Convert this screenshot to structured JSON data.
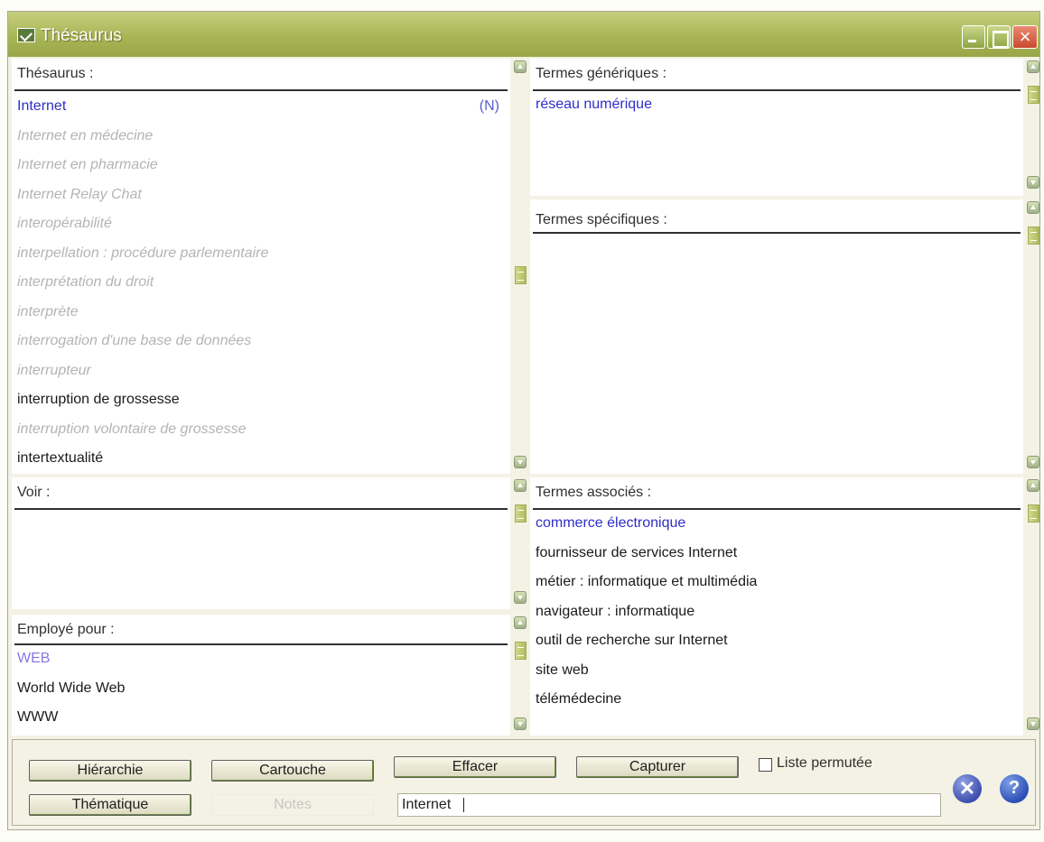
{
  "window": {
    "title": "Thésaurus"
  },
  "thesaurus": {
    "title": "Thésaurus :",
    "items": [
      {
        "label": "Internet",
        "style": "blue",
        "tag": "(N)"
      },
      {
        "label": "Internet en médecine",
        "style": "grey"
      },
      {
        "label": "Internet en pharmacie",
        "style": "grey"
      },
      {
        "label": "Internet Relay Chat",
        "style": "grey"
      },
      {
        "label": "interopérabilité",
        "style": "grey"
      },
      {
        "label": "interpellation : procédure parlementaire",
        "style": "grey"
      },
      {
        "label": "interprétation du droit",
        "style": "grey"
      },
      {
        "label": "interprète",
        "style": "grey"
      },
      {
        "label": "interrogation d'une base de données",
        "style": "grey"
      },
      {
        "label": "interrupteur",
        "style": "grey"
      },
      {
        "label": "interruption de grossesse",
        "style": "black"
      },
      {
        "label": "interruption volontaire de grossesse",
        "style": "grey"
      },
      {
        "label": "intertextualité",
        "style": "black"
      }
    ]
  },
  "voir": {
    "title": "Voir :"
  },
  "employe_pour": {
    "title": "Employé pour :",
    "items": [
      {
        "label": "WEB",
        "style": "lilac"
      },
      {
        "label": "World Wide Web",
        "style": "black"
      },
      {
        "label": "WWW",
        "style": "black"
      }
    ]
  },
  "termes_generiques": {
    "title": "Termes génériques :",
    "items": [
      {
        "label": "réseau numérique",
        "style": "blue"
      }
    ]
  },
  "termes_specifiques": {
    "title": "Termes spécifiques :"
  },
  "termes_associes": {
    "title": "Termes associés :",
    "items": [
      {
        "label": "commerce électronique",
        "style": "blue"
      },
      {
        "label": "fournisseur de services Internet",
        "style": "black"
      },
      {
        "label": "métier : informatique et multimédia",
        "style": "black"
      },
      {
        "label": "navigateur : informatique",
        "style": "black"
      },
      {
        "label": "outil de recherche sur Internet",
        "style": "black"
      },
      {
        "label": "site web",
        "style": "black"
      },
      {
        "label": "télémédecine",
        "style": "black"
      }
    ]
  },
  "buttons": {
    "hierarchie": "Hiérarchie",
    "cartouche": "Cartouche",
    "effacer": "Effacer",
    "capturer": "Capturer",
    "thematique": "Thématique",
    "notes": "Notes"
  },
  "liste_permutee": "Liste permutée",
  "search": {
    "value": "Internet"
  },
  "icons": {
    "exit": "close-circle-icon",
    "help": "help-circle-icon"
  },
  "colors": {
    "titlebar": "#a9b656",
    "link": "#2e2ec8",
    "inactive": "#b4b4b4"
  }
}
